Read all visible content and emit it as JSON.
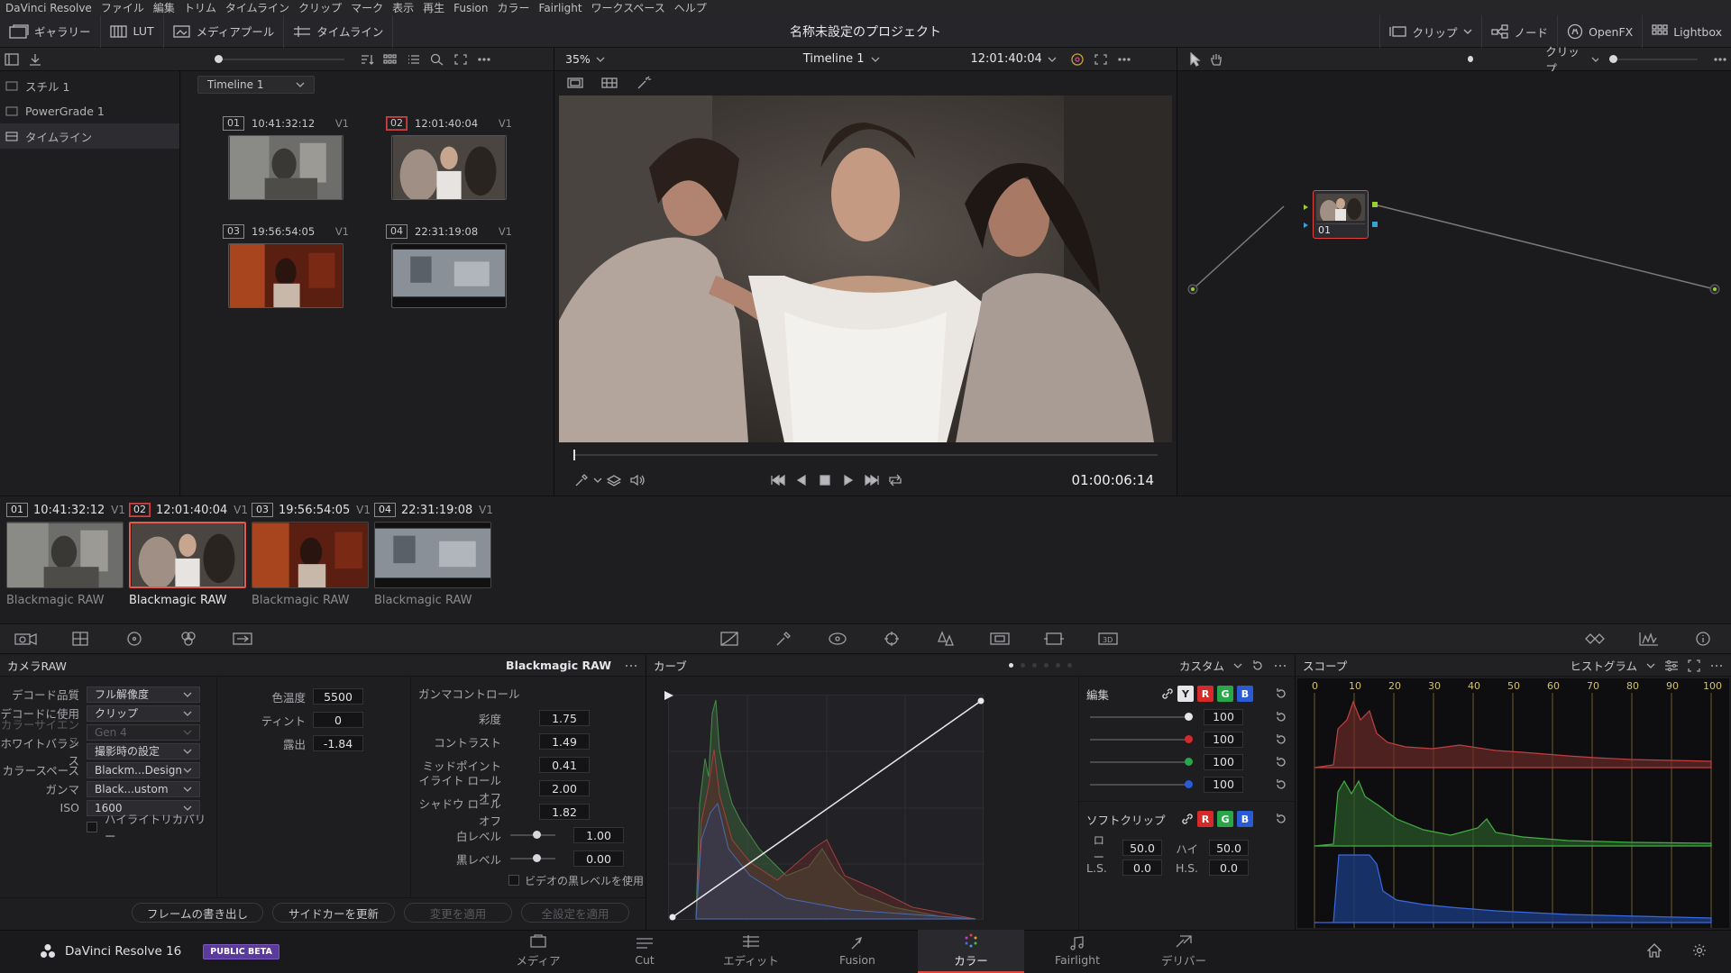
{
  "menu": [
    "DaVinci Resolve",
    "ファイル",
    "編集",
    "トリム",
    "タイムライン",
    "クリップ",
    "マーク",
    "表示",
    "再生",
    "Fusion",
    "カラー",
    "Fairlight",
    "ワークスペース",
    "ヘルプ"
  ],
  "toolbar": {
    "gallery": "ギャラリー",
    "lut": "LUT",
    "media_pool": "メディアプール",
    "timeline": "タイムライン",
    "project_title": "名称未設定のプロジェクト",
    "clip": "クリップ",
    "nodes": "ノード",
    "openfx": "OpenFX",
    "lightbox": "Lightbox"
  },
  "gallery": {
    "items": [
      "スチル 1",
      "PowerGrade 1",
      "タイムライン"
    ],
    "timeline_select": "Timeline 1"
  },
  "viewer": {
    "zoom": "35%",
    "timeline_name": "Timeline 1",
    "timecode_top": "12:01:40:04",
    "timecode": "01:00:06:14"
  },
  "node_panel": {
    "mode": "クリップ",
    "node_label": "01"
  },
  "timeline_clips": [
    {
      "num": "01",
      "tc": "10:41:32:12",
      "track": "V1",
      "codec": "Blackmagic RAW"
    },
    {
      "num": "02",
      "tc": "12:01:40:04",
      "track": "V1",
      "codec": "Blackmagic RAW"
    },
    {
      "num": "03",
      "tc": "19:56:54:05",
      "track": "V1",
      "codec": "Blackmagic RAW"
    },
    {
      "num": "04",
      "tc": "22:31:19:08",
      "track": "V1",
      "codec": "Blackmagic RAW"
    }
  ],
  "camera_raw": {
    "title": "カメラRAW",
    "codec": "Blackmagic RAW",
    "decode_quality_label": "デコード品質",
    "decode_quality": "フル解像度",
    "decode_using_label": "デコードに使用",
    "decode_using": "クリップ",
    "color_science_label": "カラーサイエンス",
    "color_science": "Gen 4",
    "white_balance_label": "ホワイトバランス",
    "white_balance": "撮影時の設定",
    "color_space_label": "カラースペース",
    "color_space": "Blackm...Design",
    "gamma_label": "ガンマ",
    "gamma": "Black...ustom",
    "iso_label": "ISO",
    "iso": "1600",
    "highlight_recovery": "ハイライトリカバリー",
    "color_temp_label": "色温度",
    "color_temp": "5500",
    "tint_label": "ティント",
    "tint": "0",
    "exposure_label": "露出",
    "exposure": "-1.84",
    "gamma_controls": "ガンマコントロール",
    "saturation_label": "彩度",
    "saturation": "1.75",
    "contrast_label": "コントラスト",
    "contrast": "1.49",
    "midpoint_label": "ミッドポイント",
    "midpoint": "0.41",
    "highlight_rolloff_label": "イライト ロールオフ",
    "highlight_rolloff": "2.00",
    "shadow_rolloff_label": "シャドウ ロールオフ",
    "shadow_rolloff": "1.82",
    "white_level_label": "白レベル",
    "white_level": "1.00",
    "black_level_label": "黒レベル",
    "black_level": "0.00",
    "video_black": "ビデオの黒レベルを使用"
  },
  "buttons": {
    "export_frame": "フレームの書き出し",
    "update_sidecar": "サイドカーを更新",
    "apply_changes": "変更を適用",
    "apply_all": "全設定を適用"
  },
  "curves": {
    "title": "カーブ",
    "mode": "カスタム",
    "edit_label": "編集",
    "channels": [
      "Y",
      "R",
      "G",
      "B"
    ],
    "values": [
      "100",
      "100",
      "100",
      "100"
    ],
    "soft_clip": "ソフトクリップ",
    "low_label": "ロー",
    "low": "50.0",
    "high_label": "ハイ",
    "high": "50.0",
    "ls_label": "L.S.",
    "ls": "0.0",
    "hs_label": "H.S.",
    "hs": "0.0"
  },
  "scope": {
    "title": "スコープ",
    "mode": "ヒストグラム",
    "ticks": [
      "0",
      "10",
      "20",
      "30",
      "40",
      "50",
      "60",
      "70",
      "80",
      "90",
      "100"
    ]
  },
  "pagebar": {
    "app_name": "DaVinci Resolve 16",
    "beta": "PUBLIC BETA",
    "pages": [
      "メディア",
      "Cut",
      "エディット",
      "Fusion",
      "カラー",
      "Fairlight",
      "デリバー"
    ]
  },
  "colors": {
    "accent_red": "#e0443c",
    "channel_red": "#d42a2a",
    "channel_green": "#2aa64a",
    "channel_blue": "#2a5ad4"
  }
}
